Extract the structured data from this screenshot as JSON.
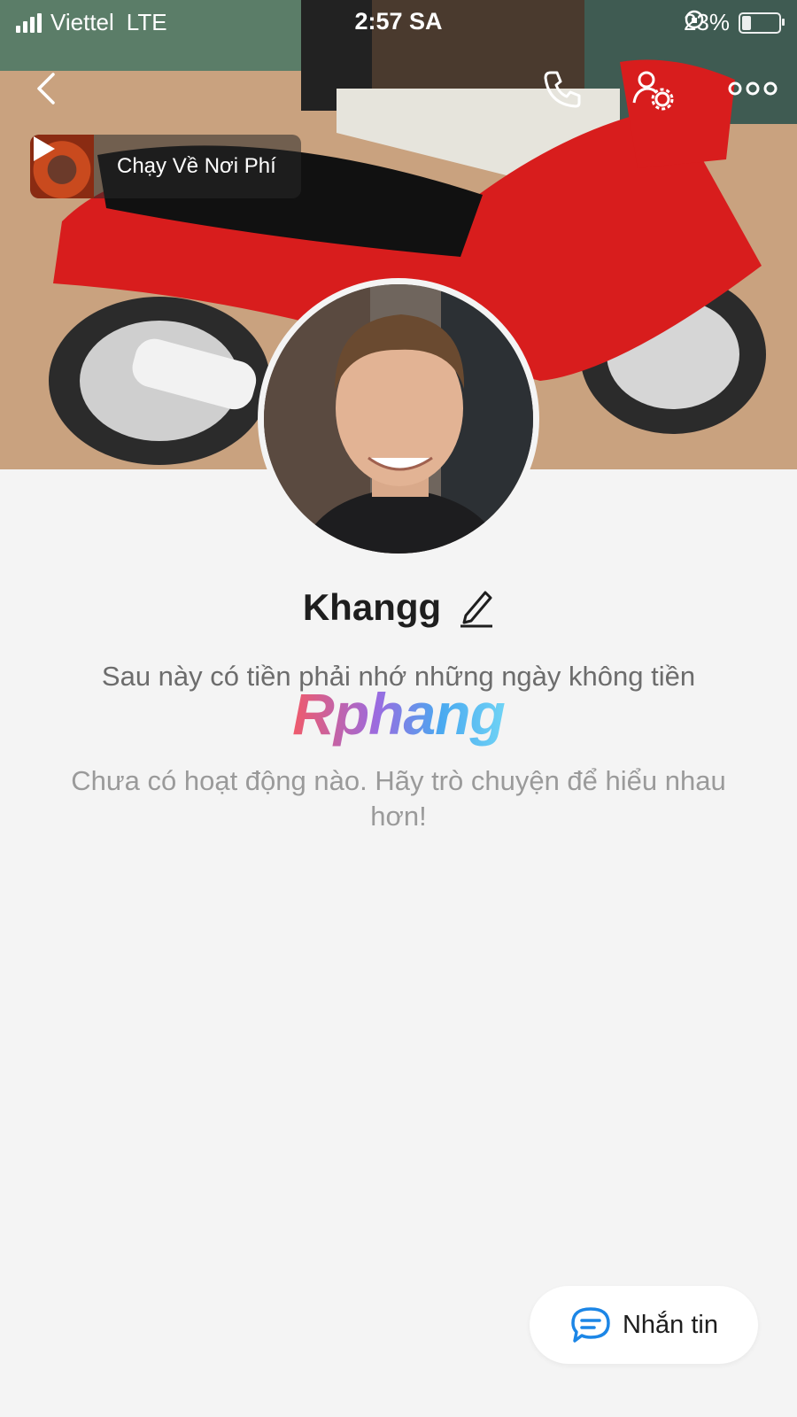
{
  "status_bar": {
    "carrier": "Viettel",
    "network": "LTE",
    "time": "2:57 SA",
    "battery_percent": "23%",
    "battery_level": 0.23
  },
  "header": {
    "back_icon": "chevron-left-icon",
    "call_icon": "phone-icon",
    "settings_icon": "user-settings-icon",
    "more_icon": "more-dots-icon"
  },
  "music": {
    "title": "Chạy Về Nơi Phí"
  },
  "profile": {
    "name": "Khangg",
    "bio": "Sau này có tiền phải nhớ những ngày không tiền",
    "watermark": "Rphang",
    "empty_activity": "Chưa có hoạt động nào. Hãy trò chuyện để hiểu nhau hơn!"
  },
  "actions": {
    "message_label": "Nhắn tin"
  },
  "colors": {
    "accent": "#1c86e6",
    "background": "#f4f4f4",
    "text_primary": "#1e1e1e",
    "text_secondary": "#6c6c6c"
  }
}
